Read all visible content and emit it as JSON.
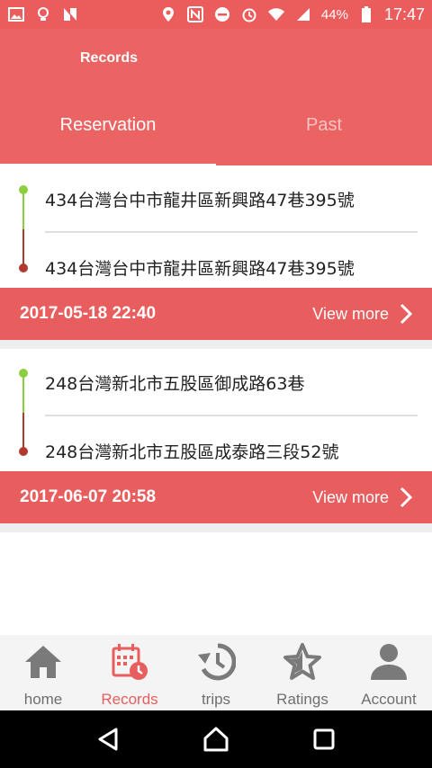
{
  "status_bar": {
    "battery_pct": "44%",
    "time": "17:47"
  },
  "header": {
    "title": "Records",
    "tabs": [
      {
        "label": "Reservation",
        "active": true
      },
      {
        "label": "Past",
        "active": false
      }
    ]
  },
  "records": [
    {
      "from": "434台灣台中市龍井區新興路47巷395號",
      "to": "434台灣台中市龍井區新興路47巷395號",
      "datetime": "2017-05-18 22:40",
      "view_more": "View more"
    },
    {
      "from": "248台灣新北市五股區御成路63巷",
      "to": "248台灣新北市五股區成泰路三段52號",
      "datetime": "2017-06-07 20:58",
      "view_more": "View more"
    }
  ],
  "bottom_nav": [
    {
      "label": "home",
      "icon": "home-icon"
    },
    {
      "label": "Records",
      "icon": "calendar-clock-icon",
      "active": true
    },
    {
      "label": "trips",
      "icon": "history-icon"
    },
    {
      "label": "Ratings",
      "icon": "star-icon"
    },
    {
      "label": "Account",
      "icon": "person-icon"
    }
  ],
  "colors": {
    "accent": "#eb5c5c",
    "start_dot": "#8ccf3e",
    "end_dot": "#b03a2e"
  }
}
